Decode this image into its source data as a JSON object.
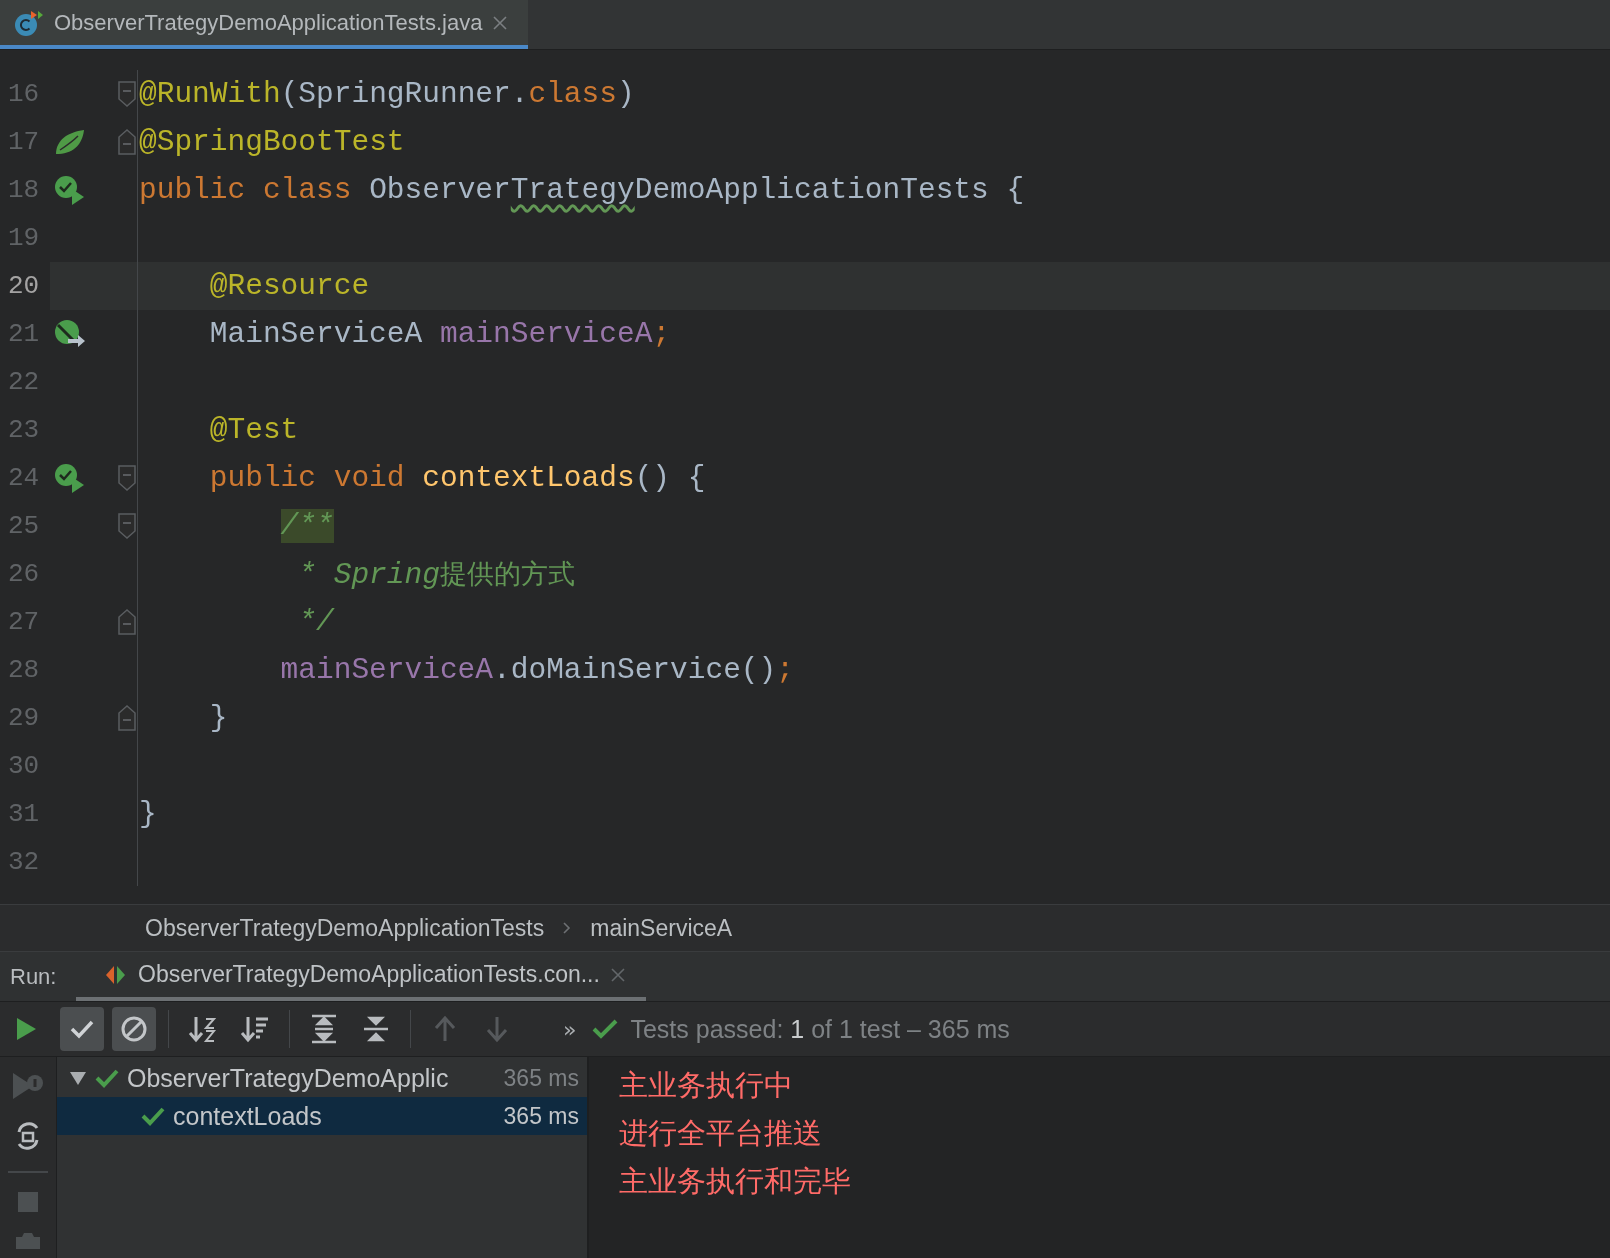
{
  "editor_tab": {
    "title": "ObserverTrategyDemoApplicationTests.java",
    "selected": true
  },
  "code_lines": [
    {
      "number": "16",
      "current": false,
      "fold": {
        "kind": "start"
      },
      "tokens": [
        {
          "kind": "annotation",
          "text": "@RunWith"
        },
        {
          "kind": "plain",
          "text": "(SpringRunner."
        },
        {
          "kind": "keyword",
          "text": "class"
        },
        {
          "kind": "plain",
          "text": ")"
        }
      ]
    },
    {
      "number": "17",
      "current": false,
      "gutter": {
        "kind": "spring-bean"
      },
      "fold": {
        "kind": "end"
      },
      "tokens": [
        {
          "kind": "annotation",
          "text": "@SpringBootTest"
        }
      ]
    },
    {
      "number": "18",
      "current": false,
      "gutter": {
        "kind": "run-test"
      },
      "tokens": [
        {
          "kind": "keyword",
          "text": "public class "
        },
        {
          "kind": "plain",
          "text": "Observer"
        },
        {
          "kind": "typo",
          "text": "Trategy"
        },
        {
          "kind": "plain",
          "text": "DemoApplicationTests {"
        }
      ]
    },
    {
      "number": "19",
      "current": false
    },
    {
      "number": "20",
      "current": true,
      "indent": {
        "kind": "member"
      },
      "tokens": [
        {
          "kind": "annotation",
          "text": "@Resource"
        }
      ]
    },
    {
      "number": "21",
      "current": false,
      "gutter": {
        "kind": "autowired"
      },
      "indent": {
        "kind": "member"
      },
      "tokens": [
        {
          "kind": "plain",
          "text": "MainServiceA "
        },
        {
          "kind": "field",
          "text": "mainServiceA"
        },
        {
          "kind": "keyword",
          "text": ";"
        }
      ]
    },
    {
      "number": "22",
      "current": false
    },
    {
      "number": "23",
      "current": false,
      "indent": {
        "kind": "member"
      },
      "tokens": [
        {
          "kind": "annotation",
          "text": "@Test"
        }
      ]
    },
    {
      "number": "24",
      "current": false,
      "gutter": {
        "kind": "run-test"
      },
      "fold": {
        "kind": "start"
      },
      "indent": {
        "kind": "member"
      },
      "tokens": [
        {
          "kind": "keyword",
          "text": "public void "
        },
        {
          "kind": "method",
          "text": "contextLoads"
        },
        {
          "kind": "plain",
          "text": "() {"
        }
      ]
    },
    {
      "number": "25",
      "current": false,
      "fold": {
        "kind": "start"
      },
      "indent": {
        "kind": "body"
      },
      "tokens": [
        {
          "kind": "doc-matched",
          "text": "/**"
        }
      ]
    },
    {
      "number": "26",
      "current": false,
      "indent": {
        "kind": "doc-body"
      },
      "tokens": [
        {
          "kind": "doc",
          "text": "* Spring"
        },
        {
          "kind": "doc-cjk",
          "text": "提供的方式"
        }
      ]
    },
    {
      "number": "27",
      "current": false,
      "fold": {
        "kind": "end"
      },
      "indent": {
        "kind": "doc-body"
      },
      "tokens": [
        {
          "kind": "doc",
          "text": "*/"
        }
      ]
    },
    {
      "number": "28",
      "current": false,
      "indent": {
        "kind": "body"
      },
      "tokens": [
        {
          "kind": "field",
          "text": "mainServiceA"
        },
        {
          "kind": "plain",
          "text": ".doMainService()"
        },
        {
          "kind": "keyword",
          "text": ";"
        }
      ]
    },
    {
      "number": "29",
      "current": false,
      "fold": {
        "kind": "end"
      },
      "indent": {
        "kind": "member"
      },
      "tokens": [
        {
          "kind": "plain",
          "text": "}"
        }
      ]
    },
    {
      "number": "30",
      "current": false
    },
    {
      "number": "31",
      "current": false,
      "tokens": [
        {
          "kind": "plain",
          "text": "}"
        }
      ]
    },
    {
      "number": "32",
      "current": false
    }
  ],
  "breadcrumbs": [
    "ObserverTrategyDemoApplicationTests",
    "mainServiceA"
  ],
  "run_panel": {
    "label": "Run:",
    "tab": {
      "title": "ObserverTrategyDemoApplicationTests.con...",
      "selected": true
    },
    "toolbar": [
      {
        "kind": "show-passed",
        "on": true
      },
      {
        "kind": "show-ignored",
        "on": true
      },
      {
        "kind": "sort-alpha",
        "on": false
      },
      {
        "kind": "sort-duration",
        "on": false
      },
      {
        "kind": "expand-all",
        "on": false
      },
      {
        "kind": "collapse-all",
        "on": false
      },
      {
        "kind": "previous",
        "on": false
      },
      {
        "kind": "next",
        "on": false
      }
    ],
    "more": "»",
    "status": {
      "label": "Tests passed:",
      "count": "1",
      "rest": "of 1 test – 365 ms"
    },
    "tree": [
      {
        "name": "ObserverTrategyDemoApplic",
        "time": "365 ms",
        "passed": true,
        "expanded": true,
        "selected": false,
        "children": [
          {
            "name": "contextLoads",
            "time": "365 ms",
            "passed": true,
            "selected": true
          }
        ]
      }
    ],
    "console": [
      "主业务执行中",
      "进行全平台推送",
      "主业务执行和完毕"
    ]
  }
}
